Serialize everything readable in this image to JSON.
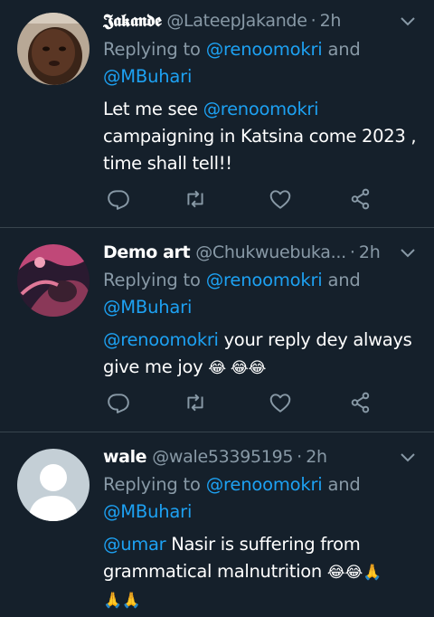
{
  "tweets": [
    {
      "name": "𝕵𝖆𝖐𝖆𝖓𝖉𝖊",
      "handle": "@LateepJakande",
      "separator": "·",
      "time": "2h",
      "replying_prefix": "Replying to ",
      "replying_mention1": "@renoomokri",
      "replying_and": " and",
      "replying_mention2": "@MBuhari",
      "body_line1_mention": "Let me see @renoomokri",
      "body_line2": "campaigning in Katsina come 2023 ,",
      "body_line3": "time shall tell!!"
    },
    {
      "name": "Demo art",
      "handle": "@Chukwuebuka...",
      "separator": "·",
      "time": "2h",
      "replying_prefix": "Replying to ",
      "replying_mention1": "@renoomokri",
      "replying_and": " and",
      "replying_mention2": "@MBuhari",
      "body_mention": "@renoomokri",
      "body_line1_rest": " your reply dey always",
      "body_line2": "give me joy ",
      "body_emoji": "😂 😂😂"
    },
    {
      "name": "wale",
      "handle": "@wale53395195",
      "separator": "·",
      "time": "2h",
      "replying_prefix": "Replying to ",
      "replying_mention1": "@renoomokri",
      "replying_and": " and",
      "replying_mention2": "@MBuhari",
      "body_mention": "@umar",
      "body_line1_rest": " Nasir is suffering from",
      "body_line2": "grammatical malnutrition ",
      "body_emoji1": "😂😂🙏",
      "body_emoji2": "🙏🙏"
    }
  ],
  "icons": {
    "reply": "reply-icon",
    "retweet": "retweet-icon",
    "like": "like-icon",
    "share": "share-icon",
    "chevron": "chevron-down-icon"
  },
  "colors": {
    "background": "#15202b",
    "secondary_text": "#8899a6",
    "link": "#1da1f2",
    "divider": "#38444d"
  }
}
